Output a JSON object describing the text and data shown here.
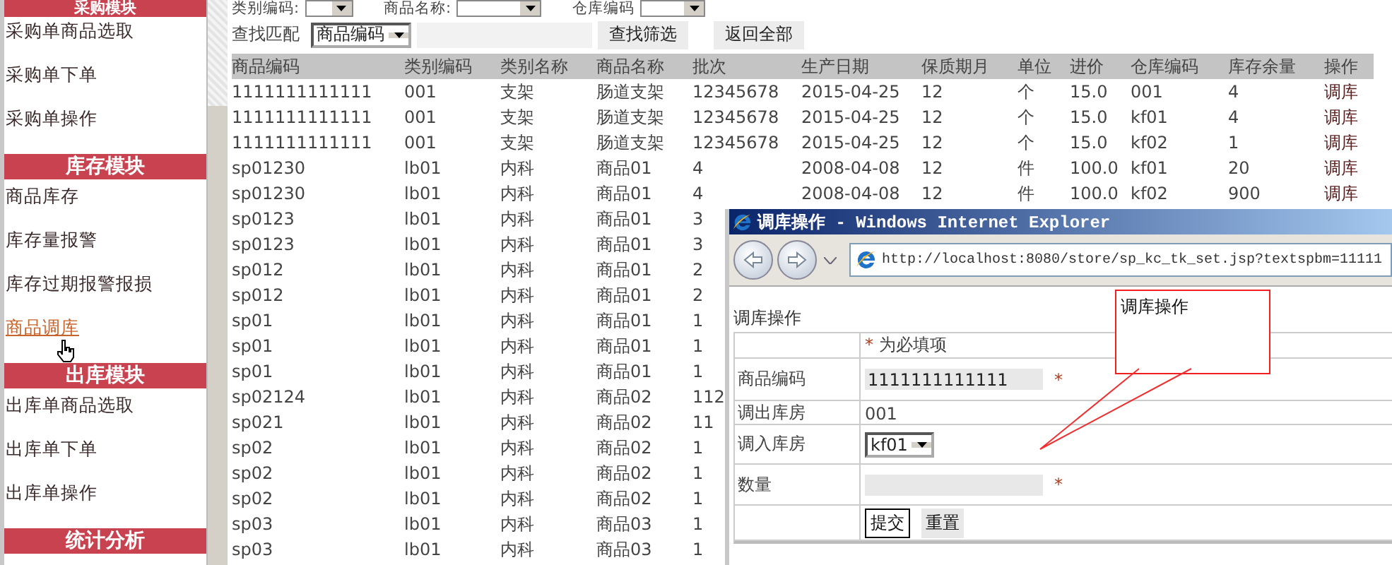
{
  "sidebar": {
    "items": [
      {
        "kind": "header",
        "label": "采购模块"
      },
      {
        "kind": "link",
        "label": "采购单商品选取",
        "selected": false
      },
      {
        "kind": "link",
        "label": "采购单下单",
        "selected": false
      },
      {
        "kind": "link",
        "label": "采购单操作",
        "selected": false
      },
      {
        "kind": "header",
        "label": "库存模块"
      },
      {
        "kind": "link",
        "label": "商品库存",
        "selected": false
      },
      {
        "kind": "link",
        "label": "库存量报警",
        "selected": false
      },
      {
        "kind": "link",
        "label": "库存过期报警报损",
        "selected": false
      },
      {
        "kind": "link",
        "label": "商品调库",
        "selected": true
      },
      {
        "kind": "header",
        "label": "出库模块"
      },
      {
        "kind": "link",
        "label": "出库单商品选取",
        "selected": false
      },
      {
        "kind": "link",
        "label": "出库单下单",
        "selected": false
      },
      {
        "kind": "link",
        "label": "出库单操作",
        "selected": false
      },
      {
        "kind": "header",
        "label": "统计分析"
      }
    ]
  },
  "filters": [
    {
      "label": "类别编码:"
    },
    {
      "label": "商品名称:"
    },
    {
      "label": "仓库编码"
    }
  ],
  "search": {
    "label": "查找匹配",
    "select": "商品编码",
    "buttons": [
      "查找筛选",
      "返回全部"
    ]
  },
  "table": {
    "columns": [
      "商品编码",
      "类别编码",
      "类别名称",
      "商品名称",
      "批次",
      "生产日期",
      "保质期月",
      "单位",
      "进价",
      "仓库编码",
      "库存余量",
      "操作"
    ],
    "rows": [
      [
        "1111111111111",
        "001",
        "支架",
        "肠道支架",
        "12345678",
        "2015-04-25",
        "12",
        "个",
        "15.0",
        "001",
        "4",
        "调库"
      ],
      [
        "1111111111111",
        "001",
        "支架",
        "肠道支架",
        "12345678",
        "2015-04-25",
        "12",
        "个",
        "15.0",
        "kf01",
        "4",
        "调库"
      ],
      [
        "1111111111111",
        "001",
        "支架",
        "肠道支架",
        "12345678",
        "2015-04-25",
        "12",
        "个",
        "15.0",
        "kf02",
        "1",
        "调库"
      ],
      [
        "sp01230",
        "lb01",
        "内科",
        "商品01",
        "4",
        "2008-04-08",
        "12",
        "件",
        "100.0",
        "kf01",
        "20",
        "调库"
      ],
      [
        "sp01230",
        "lb01",
        "内科",
        "商品01",
        "4",
        "2008-04-08",
        "12",
        "件",
        "100.0",
        "kf02",
        "900",
        "调库"
      ],
      [
        "sp0123",
        "lb01",
        "内科",
        "商品01",
        "3"
      ],
      [
        "sp0123",
        "lb01",
        "内科",
        "商品01",
        "3"
      ],
      [
        "sp012",
        "lb01",
        "内科",
        "商品01",
        "2"
      ],
      [
        "sp012",
        "lb01",
        "内科",
        "商品01",
        "2"
      ],
      [
        "sp01",
        "lb01",
        "内科",
        "商品01",
        "1"
      ],
      [
        "sp01",
        "lb01",
        "内科",
        "商品01",
        "1"
      ],
      [
        "sp01",
        "lb01",
        "内科",
        "商品01",
        "1"
      ],
      [
        "sp02124",
        "lb01",
        "内科",
        "商品02",
        "112"
      ],
      [
        "sp021",
        "lb01",
        "内科",
        "商品02",
        "11"
      ],
      [
        "sp02",
        "lb01",
        "内科",
        "商品02",
        "1"
      ],
      [
        "sp02",
        "lb01",
        "内科",
        "商品02",
        "1"
      ],
      [
        "sp02",
        "lb01",
        "内科",
        "商品02",
        "1"
      ],
      [
        "sp03",
        "lb01",
        "内科",
        "商品03",
        "1"
      ],
      [
        "sp03",
        "lb01",
        "内科",
        "商品03",
        "1"
      ]
    ]
  },
  "popup": {
    "title": "调库操作 - Windows Internet Explorer",
    "address": "http://localhost:8080/store/sp_kc_tk_set.jsp?textspbm=11111",
    "heading": "调库操作",
    "note_mark": "*",
    "note": "为必填项",
    "fields": [
      {
        "kind": "input",
        "label": "商品编码",
        "value": "1111111111111",
        "mark": "*"
      },
      {
        "kind": "static",
        "label": "调出库房",
        "value": "001"
      },
      {
        "kind": "select",
        "label": "调入库房",
        "value": "kf01"
      },
      {
        "kind": "input",
        "label": "数量",
        "mark": "*"
      }
    ],
    "buttons": [
      "提交",
      "重置"
    ]
  },
  "callout": {
    "text": "调库操作"
  }
}
